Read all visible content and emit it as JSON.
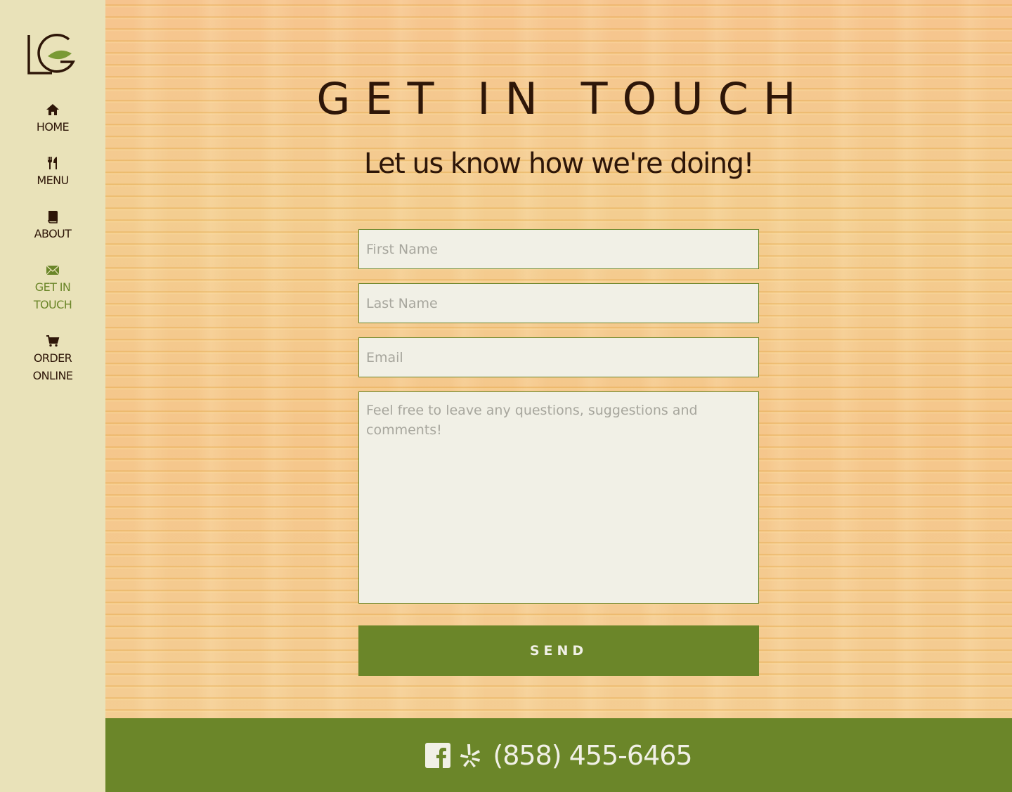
{
  "sidebar": {
    "logo_text": "LG",
    "items": [
      {
        "label": "HOME",
        "icon": "home-icon"
      },
      {
        "label": "MENU",
        "icon": "utensils-icon"
      },
      {
        "label": "ABOUT",
        "icon": "book-icon"
      },
      {
        "label_line1": "GET IN",
        "label_line2": "TOUCH",
        "icon": "envelope-icon",
        "active": true
      },
      {
        "label_line1": "ORDER",
        "label_line2": "ONLINE",
        "icon": "cart-icon"
      }
    ]
  },
  "main": {
    "title": "GET IN TOUCH",
    "subtitle": "Let us know how we're doing!",
    "form": {
      "first_name_placeholder": "First Name",
      "last_name_placeholder": "Last Name",
      "email_placeholder": "Email",
      "message_placeholder": "Feel free to leave any questions, suggestions and comments!",
      "send_label": "SEND"
    }
  },
  "footer": {
    "phone": "(858) 455-6465",
    "icons": [
      "facebook-icon",
      "yelp-icon"
    ]
  },
  "colors": {
    "accent_green": "#6b8629",
    "dark_brown": "#2e1608",
    "sidebar_bg": "#e9e2b9",
    "field_bg": "#f1f0e6"
  }
}
